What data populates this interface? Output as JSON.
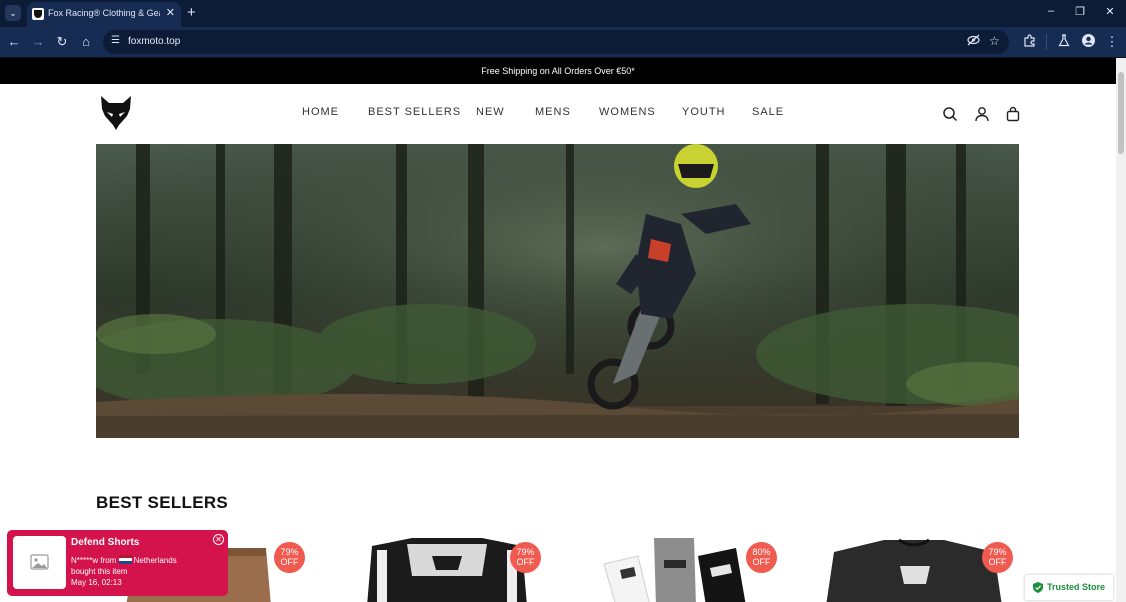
{
  "browser": {
    "tab_title": "Fox Racing® Clothing & Gear |",
    "url": "foxmoto.top"
  },
  "announcement": "Free Shipping on All Orders Over €50*",
  "nav": {
    "items": [
      "HOME",
      "BEST SELLERS",
      "NEW",
      "MENS",
      "WOMENS",
      "YOUTH",
      "SALE"
    ]
  },
  "header_icons": [
    "search-icon",
    "account-icon",
    "cart-icon"
  ],
  "best_sellers": {
    "title": "BEST SELLERS",
    "products": [
      {
        "badge_percent": "79%",
        "badge_label": "OFF",
        "image": "shorts"
      },
      {
        "badge_percent": "79%",
        "badge_label": "OFF",
        "image": "jersey"
      },
      {
        "badge_percent": "80%",
        "badge_label": "OFF",
        "image": "socks"
      },
      {
        "badge_percent": "79%",
        "badge_label": "OFF",
        "image": "tshirt"
      }
    ]
  },
  "sales_popup": {
    "title": "Defend Shorts",
    "buyer": "N*****w from",
    "country": "Netherlands",
    "action": "bought this item",
    "time": "May 16, 02:13"
  },
  "trust_badge": {
    "label": "Trusted Store"
  },
  "colors": {
    "badge": "#f05a4f",
    "popup": "#d4124b",
    "trusted": "#1c8f3c",
    "announcement_bg": "#000000"
  }
}
